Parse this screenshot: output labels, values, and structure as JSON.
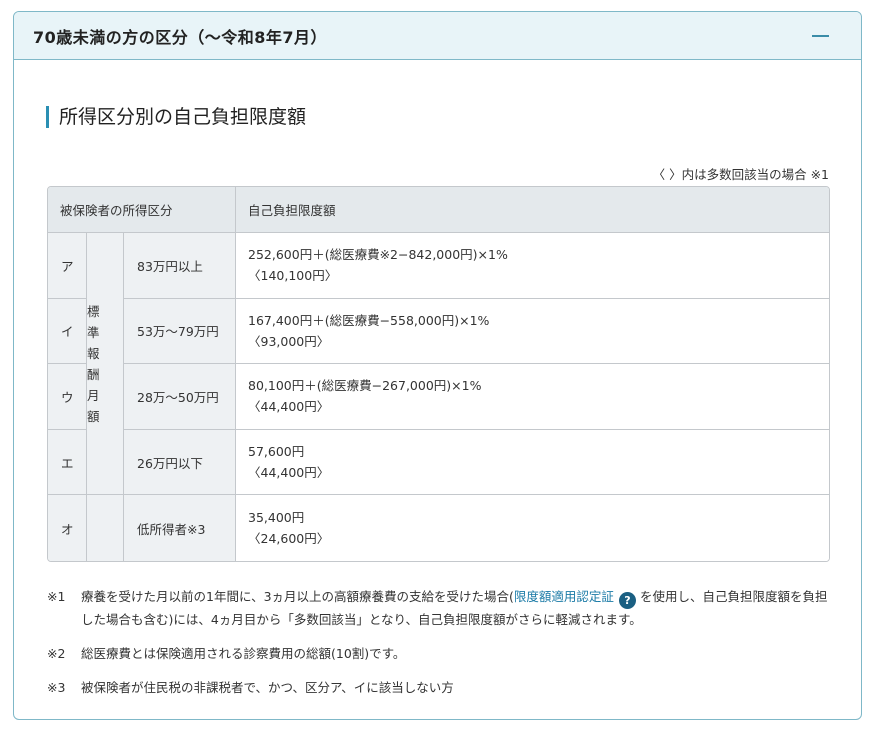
{
  "panel": {
    "title": "70歳未満の方の区分（〜令和8年7月）",
    "collapse_icon": "minus-icon"
  },
  "section": {
    "title": "所得区分別の自己負担限度額"
  },
  "note_top": "〈 〉内は多数回該当の場合 ※1",
  "table": {
    "headers": [
      "被保険者の所得区分",
      "自己負担限度額"
    ],
    "group_label_chars": [
      "標",
      "準",
      "報",
      "酬",
      "月",
      "額"
    ],
    "rows": [
      {
        "code": "ア",
        "range": "83万円以上",
        "formula": "252,600円＋(総医療費※2−842,000円)×1%",
        "multi": "〈140,100円〉"
      },
      {
        "code": "イ",
        "range": "53万〜79万円",
        "formula": "167,400円＋(総医療費−558,000円)×1%",
        "multi": "〈93,000円〉"
      },
      {
        "code": "ウ",
        "range": "28万〜50万円",
        "formula": "80,100円＋(総医療費−267,000円)×1%",
        "multi": "〈44,400円〉"
      },
      {
        "code": "エ",
        "range": "26万円以下",
        "formula": "57,600円",
        "multi": "〈44,400円〉"
      },
      {
        "code": "オ",
        "range": "低所得者※3",
        "formula": "35,400円",
        "multi": "〈24,600円〉"
      }
    ]
  },
  "footnotes": {
    "fn1": {
      "mark": "※1",
      "text_before": "療養を受けた月以前の1年間に、3ヵ月以上の高額療養費の支給を受けた場合(",
      "link": "限度額適用認定証",
      "help_icon_label": "?",
      "text_after": "を使用し、自己負担限度額を負担した場合も含む)には、4ヵ月目から「多数回該当」となり、自己負担限度額がさらに軽減されます。"
    },
    "fn2": {
      "mark": "※2",
      "text": "総医療費とは保険適用される診察費用の総額(10割)です。"
    },
    "fn3": {
      "mark": "※3",
      "text": "被保険者が住民税の非課税者で、かつ、区分ア、イに該当しない方"
    }
  },
  "colors": {
    "accent": "#2a8fb3",
    "header_bg": "#e8f4f8",
    "link": "#1a7aa6",
    "help_icon": "#1a5f82"
  }
}
